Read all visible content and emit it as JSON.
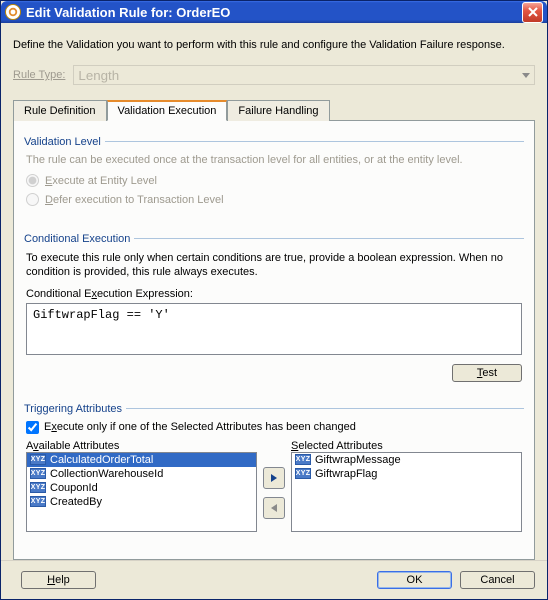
{
  "title": "Edit Validation Rule for: OrderEO",
  "description": "Define the Validation you want to perform with this rule and configure the Validation Failure response.",
  "ruleType": {
    "label": "Rule Type:",
    "value": "Length"
  },
  "tabs": {
    "ruleDef": "Rule Definition",
    "valExec": "Validation Execution",
    "failHandling": "Failure Handling"
  },
  "validationLevel": {
    "title": "Validation Level",
    "desc": "The rule can be executed once at the transaction level for all entities, or at the entity level.",
    "opt1": "Execute at Entity Level",
    "opt2": "Defer execution to Transaction Level"
  },
  "conditional": {
    "title": "Conditional Execution",
    "desc": "To execute this rule only when certain conditions are true, provide a boolean expression. When no condition is provided, this rule always executes.",
    "exprLabel": "Conditional Execution Expression:",
    "expr": "GiftwrapFlag == 'Y'",
    "testBtn": "Test"
  },
  "triggering": {
    "title": "Triggering Attributes",
    "chkLabel": "Execute only if one of the Selected Attributes has been changed",
    "availLabel": "Available Attributes",
    "selLabel": "Selected Attributes",
    "available": [
      "CalculatedOrderTotal",
      "CollectionWarehouseId",
      "CouponId",
      "CreatedBy"
    ],
    "selected": [
      "GiftwrapMessage",
      "GiftwrapFlag"
    ]
  },
  "footer": {
    "help": "Help",
    "ok": "OK",
    "cancel": "Cancel"
  }
}
